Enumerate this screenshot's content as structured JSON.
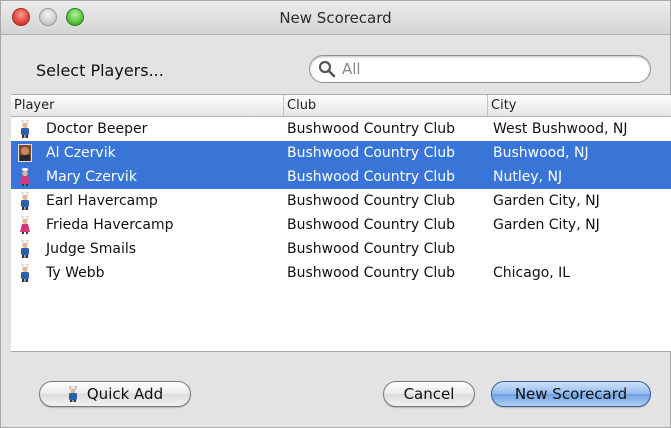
{
  "window": {
    "title": "New Scorecard"
  },
  "header": {
    "prompt": "Select Players...",
    "search_placeholder": "All"
  },
  "table": {
    "columns": [
      "Player",
      "Club",
      "City"
    ],
    "rows": [
      {
        "player": "Doctor Beeper",
        "club": "Bushwood Country Club",
        "city": "West Bushwood, NJ",
        "selected": false,
        "avatar": "male-golfer-icon"
      },
      {
        "player": "Al Czervik",
        "club": "Bushwood Country Club",
        "city": "Bushwood, NJ",
        "selected": true,
        "avatar": "photo-avatar-icon"
      },
      {
        "player": "Mary Czervik",
        "club": "Bushwood Country Club",
        "city": "Nutley, NJ",
        "selected": true,
        "avatar": "female-golfer-icon"
      },
      {
        "player": "Earl Havercamp",
        "club": "Bushwood Country Club",
        "city": "Garden City, NJ",
        "selected": false,
        "avatar": "male-golfer-icon"
      },
      {
        "player": "Frieda Havercamp",
        "club": "Bushwood Country Club",
        "city": "Garden City, NJ",
        "selected": false,
        "avatar": "female-golfer-icon"
      },
      {
        "player": "Judge Smails",
        "club": "Bushwood Country Club",
        "city": "",
        "selected": false,
        "avatar": "male-golfer-icon"
      },
      {
        "player": "Ty Webb",
        "club": "Bushwood Country Club",
        "city": "Chicago, IL",
        "selected": false,
        "avatar": "male-golfer-icon"
      }
    ]
  },
  "footer": {
    "quick_add_label": "Quick Add",
    "cancel_label": "Cancel",
    "new_scorecard_label": "New Scorecard"
  },
  "colors": {
    "selection": "#3875d7",
    "primary_button": "#6fa0e4"
  }
}
